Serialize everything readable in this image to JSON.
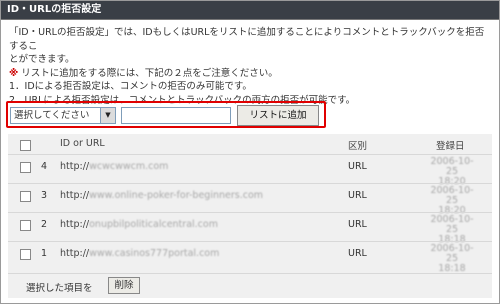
{
  "title": "ID・URLの拒否設定",
  "description": {
    "line1": "「ID・URLの拒否設定」では、IDもしくはURLをリストに追加することによりコメントとトラックバックを拒否するこ",
    "line2": "とができます。",
    "note_mark": "※",
    "line3": " リストに追加をする際には、下記の２点をご注意ください。",
    "line4": "1．IDによる拒否設定は、コメントの拒否のみ可能です。",
    "line5": "2．URLによる拒否設定は、コメントとトラックバックの両方の拒否が可能です。"
  },
  "form": {
    "select_value": "選択してください",
    "input_value": "",
    "add_button": "リストに追加"
  },
  "table": {
    "col_id_url": "ID or URL",
    "col_type": "区別",
    "col_date": "登録日",
    "rows": [
      {
        "num": "4",
        "url_prefix": "http://",
        "url_rest": "wcwcwwcm.com",
        "type": "URL",
        "date1": "2006-10-25",
        "date2": "18:20"
      },
      {
        "num": "3",
        "url_prefix": "http://",
        "url_rest": "www.online-poker-for-beginners.com",
        "type": "URL",
        "date1": "2006-10-25",
        "date2": "18:20"
      },
      {
        "num": "2",
        "url_prefix": "http://",
        "url_rest": "onupbilpoliticalcentral.com",
        "type": "URL",
        "date1": "2006-10-25",
        "date2": "18:18"
      },
      {
        "num": "1",
        "url_prefix": "http://",
        "url_rest": "www.casinos777portal.com",
        "type": "URL",
        "date1": "2006-10-25",
        "date2": "18:18"
      }
    ]
  },
  "footer": {
    "selected_label": "選択した項目を",
    "delete_button": "削除"
  }
}
